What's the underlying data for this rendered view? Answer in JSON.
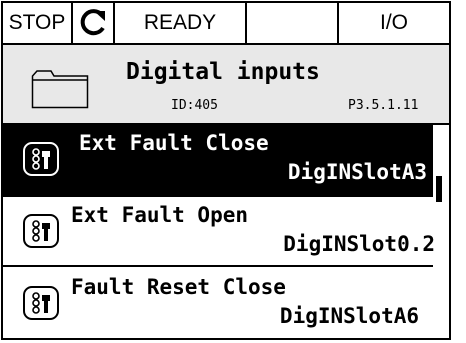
{
  "statusbar": {
    "stop": "STOP",
    "direction_icon": "rotate-direction-icon",
    "ready": "READY",
    "blank": "",
    "io": "I/O"
  },
  "header": {
    "icon": "folder-icon",
    "title": "Digital inputs",
    "id": "ID:405",
    "code": "P3.5.1.11"
  },
  "items": [
    {
      "name": "Ext Fault Close",
      "value": "DigINSlotA3",
      "icon": "parameter-icon",
      "selected": true
    },
    {
      "name": "Ext Fault Open",
      "value": "DigINSlot0.2",
      "icon": "parameter-icon",
      "selected": false
    },
    {
      "name": "Fault Reset Close",
      "value": "DigINSlotA6",
      "icon": "parameter-icon",
      "selected": false
    }
  ],
  "colors": {
    "selected_bg": "#000000",
    "header_bg": "#e8e8e8",
    "text": "#000000"
  }
}
